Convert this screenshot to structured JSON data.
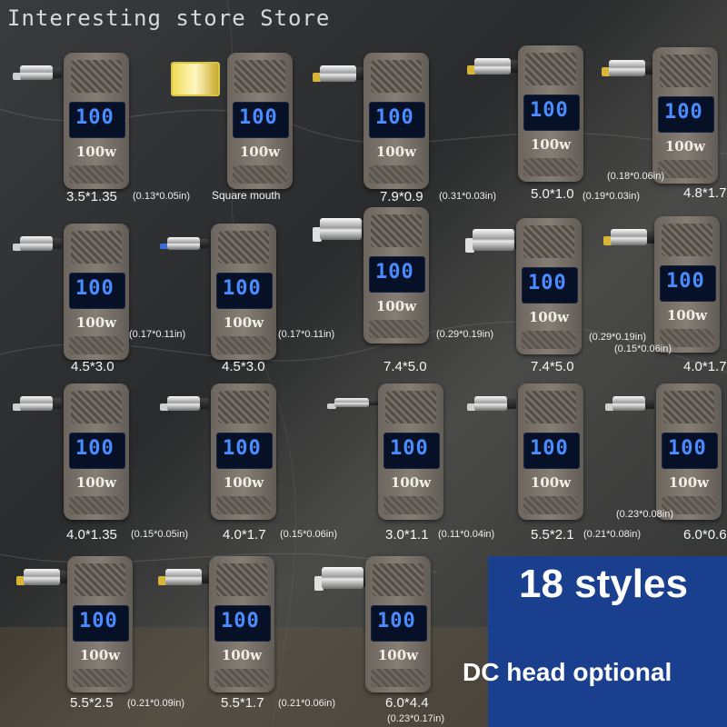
{
  "store_title": "Interesting store Store",
  "banner": {
    "line1": "18 styles",
    "line2": "DC head optional"
  },
  "colors": {
    "banner_bg": "#1a3f8f",
    "screen_digits": "#4a8cff",
    "background": "#2e2f30"
  },
  "products": [
    {
      "size": "3.5*1.35",
      "inch": "(0.13*0.05in)",
      "screen": "100",
      "watt": "100w",
      "tip": "silver"
    },
    {
      "size": "Square mouth",
      "inch": "",
      "screen": "100",
      "watt": "100w",
      "tip": "square"
    },
    {
      "size": "7.9*0.9",
      "inch": "(0.31*0.03in)",
      "screen": "100",
      "watt": "100w",
      "tip": "gold"
    },
    {
      "size": "5.0*1.0",
      "inch": "(0.19*0.03in)",
      "screen": "100",
      "watt": "100w",
      "tip": "gold"
    },
    {
      "size": "4.8*1.7",
      "inch": "(0.18*0.06in)",
      "screen": "100",
      "watt": "100w",
      "tip": "gold"
    },
    {
      "size": "4.5*3.0",
      "inch": "(0.17*0.11in)",
      "screen": "100",
      "watt": "100w",
      "tip": "silver"
    },
    {
      "size": "4.5*3.0",
      "inch": "(0.17*0.11in)",
      "screen": "100",
      "watt": "100w",
      "tip": "blue"
    },
    {
      "size": "7.4*5.0",
      "inch": "(0.29*0.19in)",
      "screen": "100",
      "watt": "100w",
      "tip": "silver-wide"
    },
    {
      "size": "7.4*5.0",
      "inch": "(0.29*0.19in)",
      "screen": "100",
      "watt": "100w",
      "tip": "silver-wide"
    },
    {
      "size": "4.0*1.7",
      "inch": "(0.15*0.06in)",
      "screen": "100",
      "watt": "100w",
      "tip": "gold"
    },
    {
      "size": "4.0*1.35",
      "inch": "(0.15*0.05in)",
      "screen": "100",
      "watt": "100w",
      "tip": "silver"
    },
    {
      "size": "4.0*1.7",
      "inch": "(0.15*0.06in)",
      "screen": "100",
      "watt": "100w",
      "tip": "silver"
    },
    {
      "size": "3.0*1.1",
      "inch": "(0.11*0.04in)",
      "screen": "100",
      "watt": "100w",
      "tip": "silver-thin"
    },
    {
      "size": "5.5*2.1",
      "inch": "(0.21*0.08in)",
      "screen": "100",
      "watt": "100w",
      "tip": "silver"
    },
    {
      "size": "6.0*0.6",
      "inch": "(0.23*0.08in)",
      "screen": "100",
      "watt": "100w",
      "tip": "silver"
    },
    {
      "size": "5.5*2.5",
      "inch": "(0.21*0.09in)",
      "screen": "100",
      "watt": "100w",
      "tip": "gold"
    },
    {
      "size": "5.5*1.7",
      "inch": "(0.21*0.06in)",
      "screen": "100",
      "watt": "100w",
      "tip": "gold"
    },
    {
      "size": "6.0*4.4",
      "inch": "(0.23*0.17in)",
      "screen": "100",
      "watt": "100w",
      "tip": "silver-wide"
    }
  ]
}
